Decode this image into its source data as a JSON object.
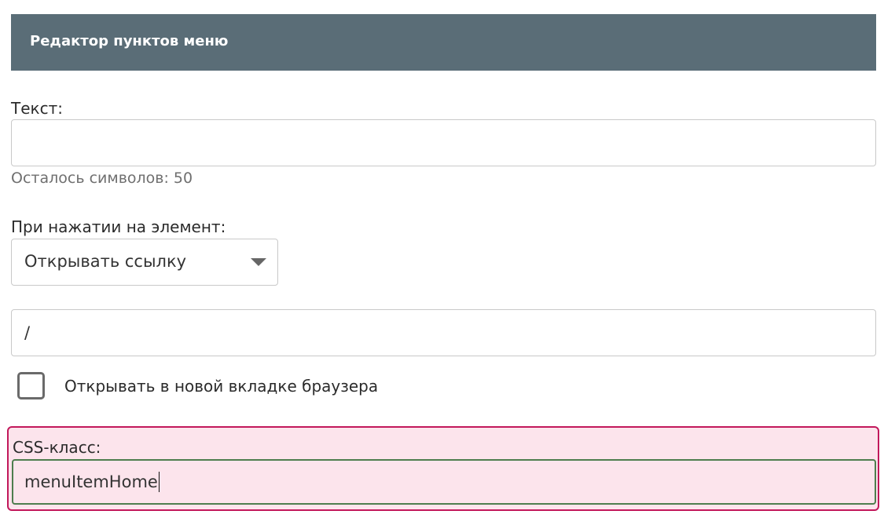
{
  "header": {
    "title": "Редактор пунктов меню"
  },
  "text_field": {
    "label": "Текст:",
    "value": "",
    "remaining_label": "Осталось символов: 50"
  },
  "action_field": {
    "label": "При нажатии на элемент:",
    "selected": "Открывать ссылку"
  },
  "link_field": {
    "value": "/"
  },
  "new_tab": {
    "label": "Открывать в новой вкладке браузера",
    "checked": false
  },
  "css_class": {
    "label": "CSS-класс:",
    "value": "menuItemHome"
  },
  "colors": {
    "header_bg": "#5a6d77",
    "highlight_border": "#c2185b",
    "highlight_bg": "#fce4ec",
    "focus_border": "#4e7d4e"
  }
}
